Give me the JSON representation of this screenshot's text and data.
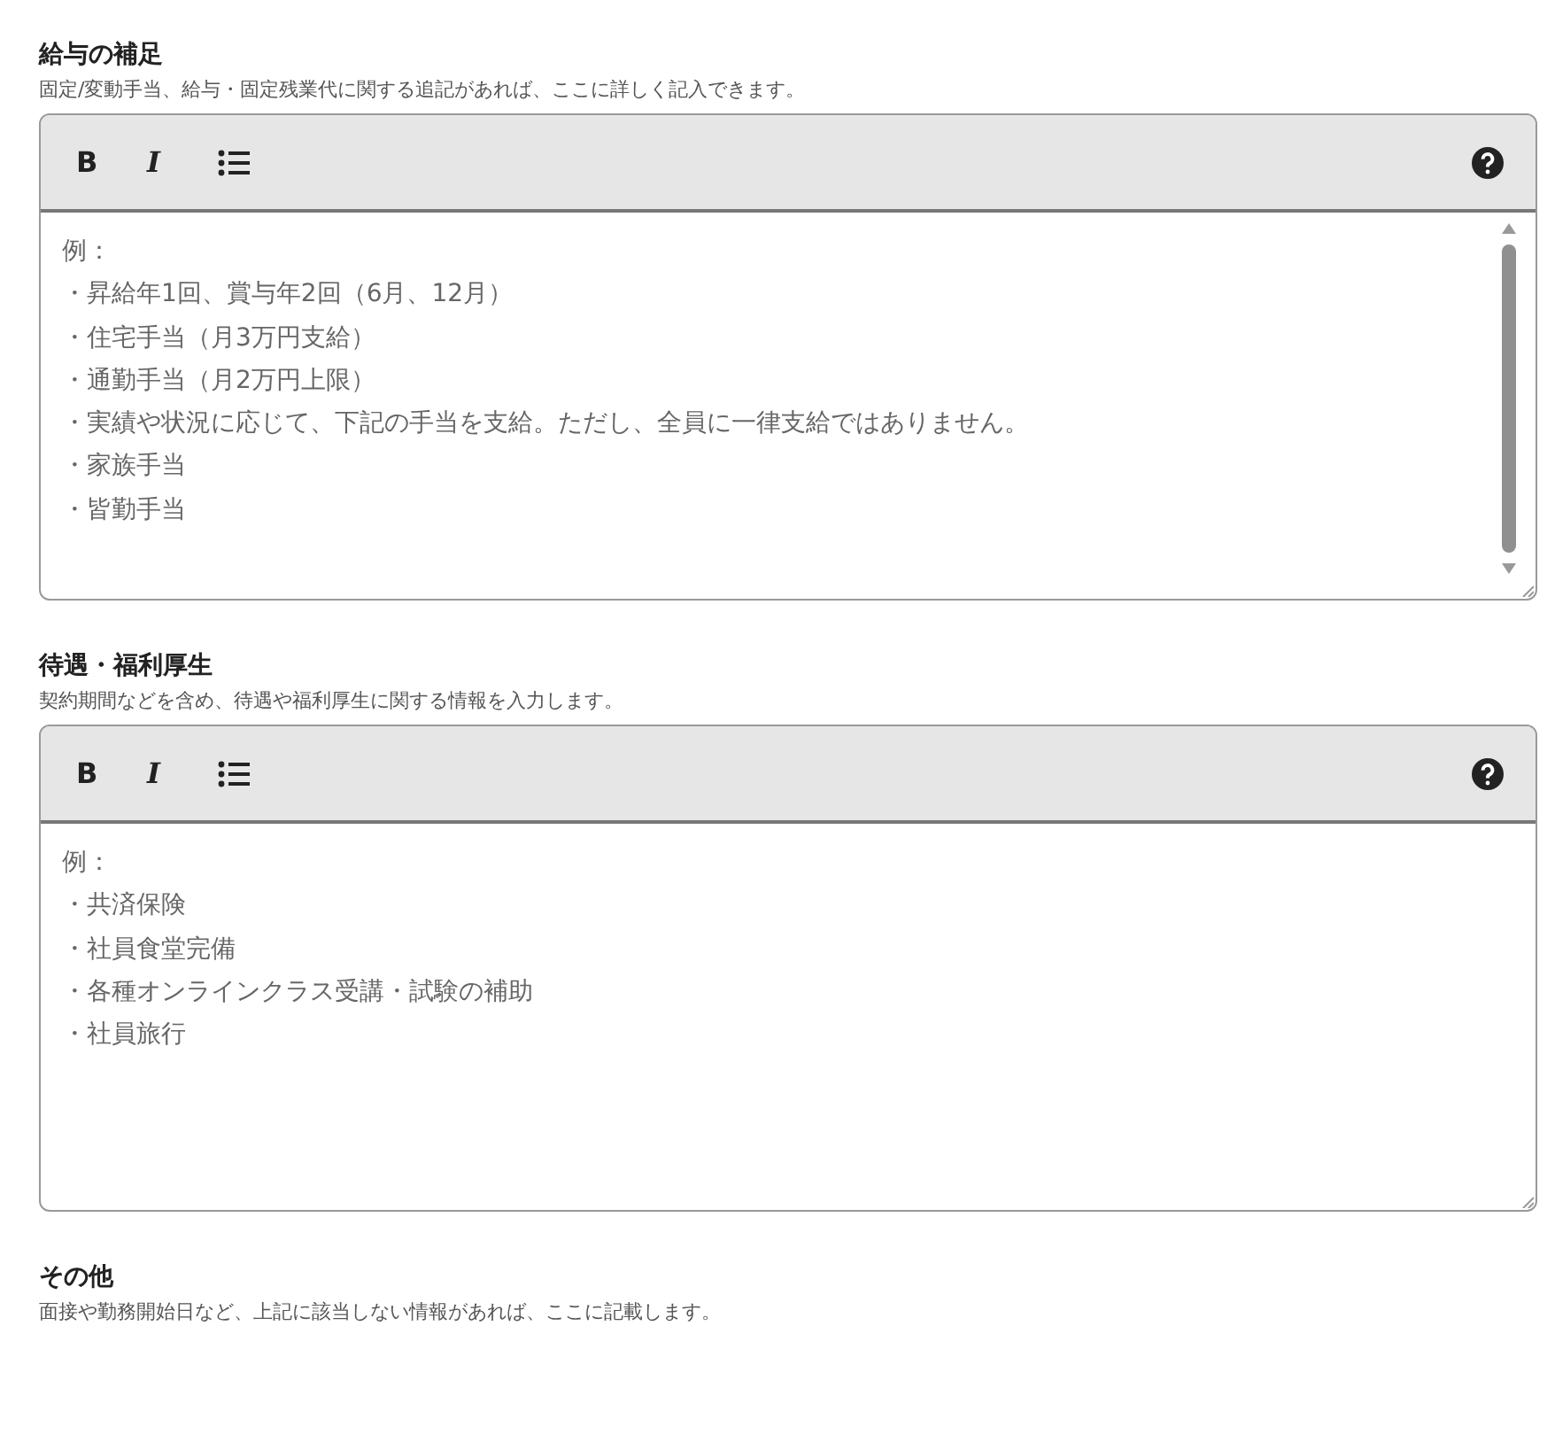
{
  "sections": [
    {
      "title": "給与の補足",
      "description": "固定/変動手当、給与・固定残業代に関する追記があれば、ここに詳しく記入できます。",
      "editor": {
        "toolbar": [
          "B",
          "I"
        ],
        "placeholder_lines": [
          "例：",
          "・昇給年1回、賞与年2回（6月、12月）",
          "・住宅手当（月3万円支給）",
          "・通勤手当（月2万円上限）",
          "・実績や状況に応じて、下記の手当を支給。ただし、全員に一律支給ではありません。",
          "・家族手当",
          "・皆勤手当"
        ],
        "scrollbar": true
      }
    },
    {
      "title": "待遇・福利厚生",
      "description": "契約期間などを含め、待遇や福利厚生に関する情報を入力します。",
      "editor": {
        "toolbar": [
          "B",
          "I"
        ],
        "placeholder_lines": [
          "例：",
          "・共済保険",
          "・社員食堂完備",
          "・各種オンラインクラス受講・試験の補助",
          "・社員旅行"
        ],
        "scrollbar": false
      }
    },
    {
      "title": "その他",
      "description": "面接や勤務開始日など、上記に該当しない情報があれば、ここに記載します。"
    }
  ]
}
